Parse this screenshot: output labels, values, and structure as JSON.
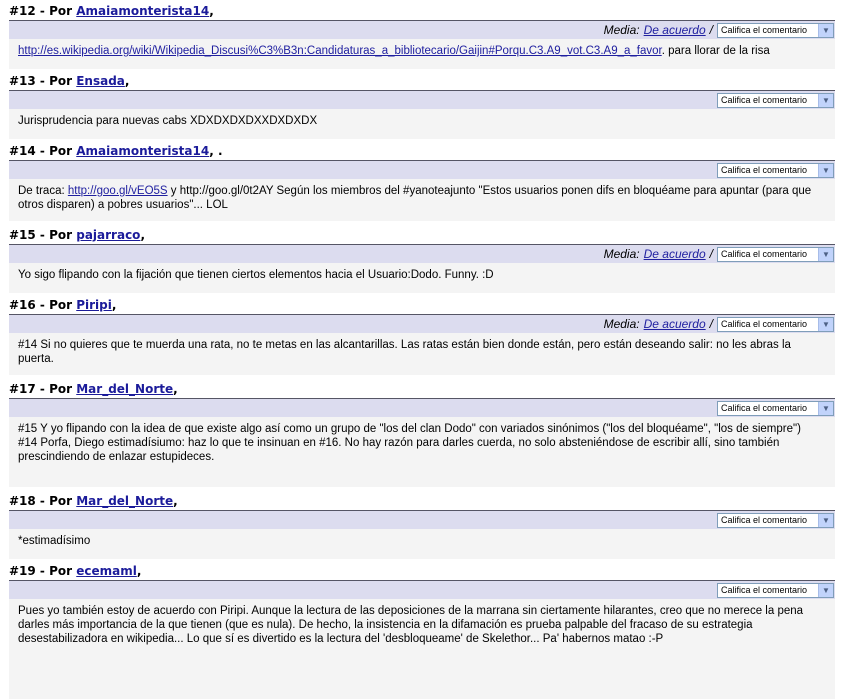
{
  "rate_options": {
    "placeholder": "Califica el comentario",
    "agree_label": "De acuerdo",
    "media_label": "Media:",
    "separator": "/"
  },
  "comments": [
    {
      "num": "#12",
      "by": "Por",
      "author": "Amaiamonteristа14",
      "suffix": ",",
      "media": true,
      "body": [
        {
          "link": "http://es.wikipedia.org/wiki/Wikipedia_Discusi%C3%B3n:Candidaturas_a_bibliotecario/Gaijin#Porqu.C3.A9_vot.C3.A9_a_favor",
          "text": ". para llorar de la risa"
        }
      ]
    },
    {
      "num": "#13",
      "by": "Por",
      "author": "Ensada",
      "suffix": ",",
      "media": false,
      "body": [
        {
          "text": "Jurisprudencia para nuevas cabs XDXDXDXDXXDXDXDX"
        }
      ]
    },
    {
      "num": "#14",
      "by": "Por",
      "author": "Amaiamonteristа14",
      "suffix": ", .",
      "media": false,
      "body": [
        {
          "pre": "De traca: ",
          "link": "http://goo.gl/vEO5S",
          "text": " y http://goo.gl/0t2AY Según los miembros del #yanoteajunto \"Estos usuarios ponen difs en bloquéame para apuntar (para que otros disparen) a pobres usuarios\"... LOL"
        }
      ]
    },
    {
      "num": "#15",
      "by": "Por",
      "author": "pajarraco",
      "suffix": ",",
      "media": true,
      "body": [
        {
          "text": "Yo sigo flipando con la fijación que tienen ciertos elementos hacia el Usuario:Dodo. Funny. :D"
        }
      ]
    },
    {
      "num": "#16",
      "by": "Por",
      "author": "Piripi",
      "suffix": ",",
      "media": true,
      "body": [
        {
          "text": "#14 Si no quieres que te muerda una rata, no te metas en las alcantarillas. Las ratas están bien donde están, pero están deseando salir: no les abras la puerta."
        }
      ]
    },
    {
      "num": "#17",
      "by": "Por",
      "author": "Mar_del_Norte",
      "suffix": ",",
      "media": false,
      "body": [
        {
          "text": "#15 Y yo flipando con la idea de que existe algo así como un grupo de \"los del clan Dodo\" con variados sinónimos (\"los del bloquéame\", \"los de siempre\")"
        },
        {
          "text": "#14 Porfa, Diego estimadísiumo: haz lo que te insinuan en #16. No hay razón para darles cuerda, no solo absteniéndose de escribir allí, sino también prescindiendo de enlazar estupideces."
        }
      ]
    },
    {
      "num": "#18",
      "by": "Por",
      "author": "Mar_del_Norte",
      "suffix": ",",
      "media": false,
      "body": [
        {
          "text": "*estimadísimo"
        }
      ]
    },
    {
      "num": "#19",
      "by": "Por",
      "author": "ecemaml",
      "suffix": ",",
      "media": false,
      "body": [
        {
          "text": "Pues yo también estoy de acuerdo con Piripi. Aunque la lectura de las deposiciones de la marrana sin ciertamente hilarantes, creo que no merece la pena darles más importancia de la que tienen (que es nula). De hecho, la insistencia en la difamación es prueba palpable del fracaso de su estrategia desestabilizadora en wikipedia... Lo que sí es divertido es la lectura del 'desbloqueame' de Skelethor... Pa' habernos matao :-P"
        }
      ]
    }
  ]
}
